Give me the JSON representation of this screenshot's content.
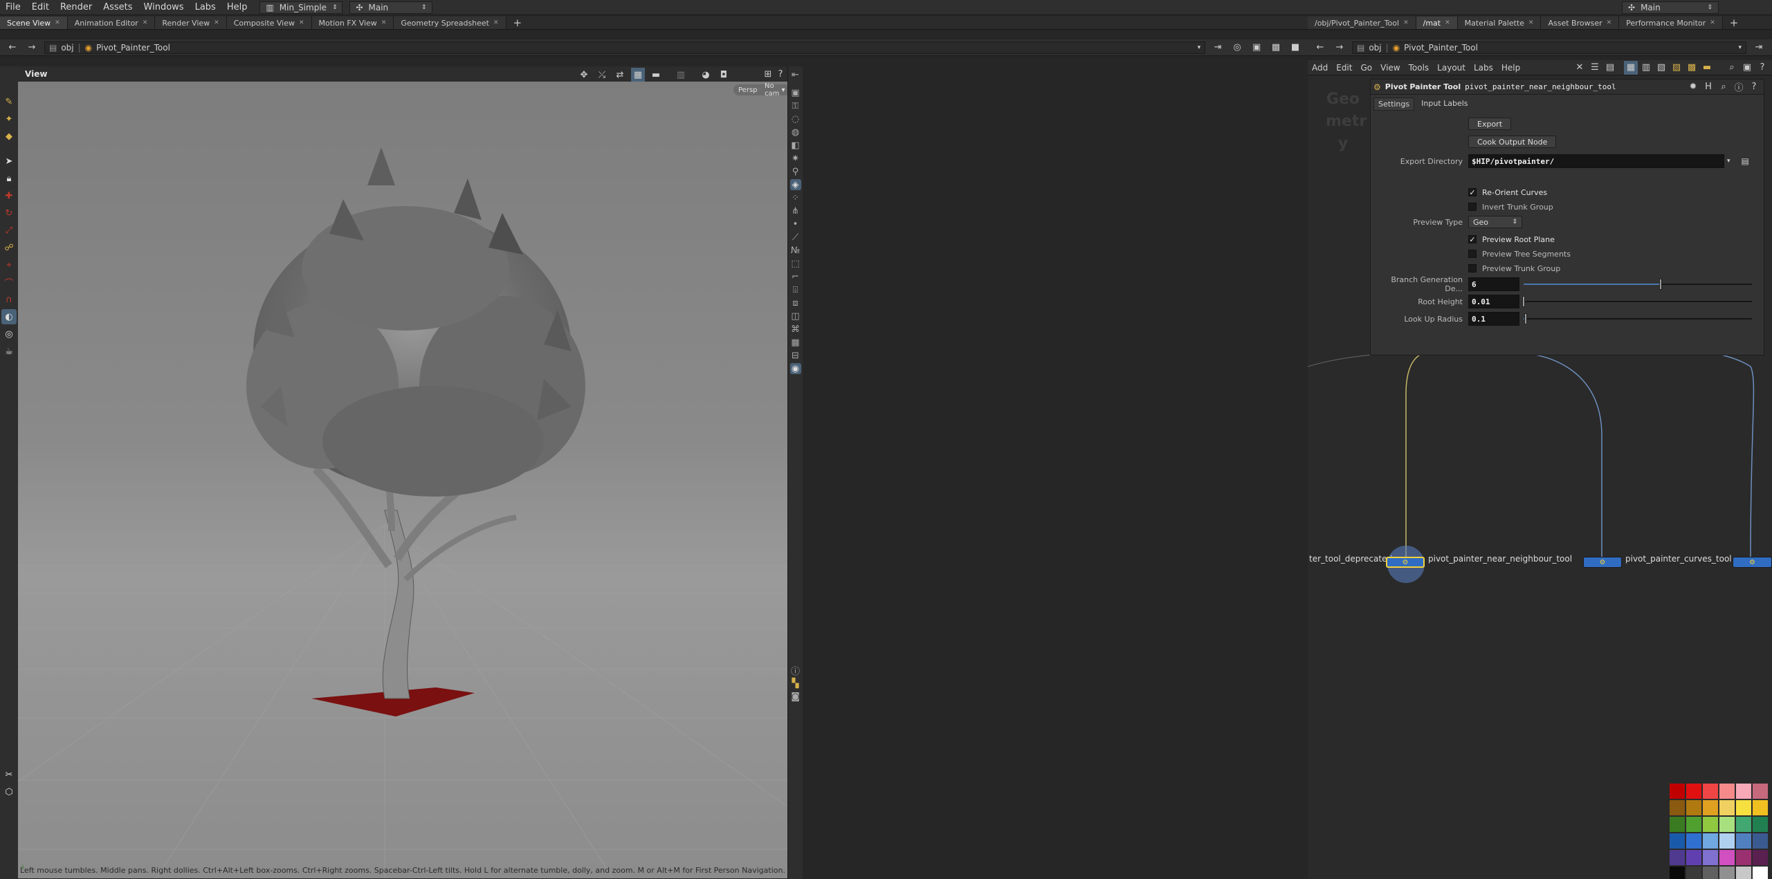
{
  "menubar": {
    "items": [
      "File",
      "Edit",
      "Render",
      "Assets",
      "Windows",
      "Labs",
      "Help"
    ],
    "desktop": "Min_Simple",
    "context": "Main",
    "right_context": "Main"
  },
  "left_tabs": [
    "Scene View",
    "Animation Editor",
    "Render View",
    "Composite View",
    "Motion FX View",
    "Geometry Spreadsheet"
  ],
  "right_tabs": [
    "/obj/Pivot_Painter_Tool",
    "/mat",
    "Material Palette",
    "Asset Browser",
    "Performance Monitor"
  ],
  "left_path": {
    "root": "obj",
    "node": "Pivot_Painter_Tool"
  },
  "right_path": {
    "root": "obj",
    "node": "Pivot_Painter_Tool"
  },
  "viewport": {
    "title": "View",
    "camera_persp": "Persp",
    "camera_name": "No cam",
    "status": "Left mouse tumbles. Middle pans. Right dollies. Ctrl+Alt+Left box-zooms. Ctrl+Right zooms. Spacebar-Ctrl-Left tilts. Hold L for alternate tumble, dolly, and zoom.     M or Alt+M for First Person Navigation."
  },
  "network_menu": [
    "Add",
    "Edit",
    "Go",
    "View",
    "Tools",
    "Layout",
    "Labs",
    "Help"
  ],
  "network_watermark": "Geo metr y",
  "params": {
    "node_type": "Pivot Painter Tool",
    "node_name": "pivot_painter_near_neighbour_tool",
    "tabs": [
      "Settings",
      "Input Labels"
    ],
    "export_btn": "Export",
    "cook_btn": "Cook Output Node",
    "export_dir_label": "Export Directory",
    "export_dir_value": "$HIP/pivotpainter/",
    "reorient_label": "Re-Orient Curves",
    "reorient_checked": true,
    "invert_trunk_label": "Invert Trunk Group",
    "invert_trunk_checked": false,
    "preview_type_label": "Preview Type",
    "preview_type_value": "Geo",
    "preview_root_label": "Preview Root Plane",
    "preview_root_checked": true,
    "preview_tree_label": "Preview Tree Segments",
    "preview_tree_checked": false,
    "preview_trunk_label": "Preview Trunk Group",
    "preview_trunk_checked": false,
    "branch_gen_label": "Branch Generation De...",
    "branch_gen_value": "6",
    "branch_gen_fraction": 0.6,
    "root_height_label": "Root Height",
    "root_height_value": "0.01",
    "root_height_fraction": 0.0,
    "lookup_label": "Look Up Radius",
    "lookup_value": "0.1",
    "lookup_fraction": 0.01
  },
  "nodes": {
    "left_label": "ter_tool_deprecated",
    "center_label": "pivot_painter_near_neighbour_tool",
    "right_label": "pivot_painter_curves_tool"
  },
  "colors": {
    "node_selected": "#f5d23a",
    "node_blue": "#2f6cc2",
    "root_plane": "#7a1010",
    "wire_yellow": "#c8b967",
    "wire_blue": "#6e8fbf"
  },
  "palette": [
    [
      "#c00000",
      "#e01010",
      "#f04545",
      "#f58a8a",
      "#f7a9b8",
      "#c7697c"
    ],
    [
      "#8a5a10",
      "#b07a10",
      "#e0a020",
      "#f0d060",
      "#f5e040",
      "#f0c020"
    ],
    [
      "#3a7a20",
      "#50a030",
      "#90c840",
      "#a8e080",
      "#40a870",
      "#208050"
    ],
    [
      "#1a5aaa",
      "#3070d0",
      "#70a8e0",
      "#b0d0f0",
      "#5080c0",
      "#3a5a90"
    ],
    [
      "#503a90",
      "#6040b0",
      "#8070d0",
      "#d050c0",
      "#9a3070",
      "#5a2050"
    ],
    [
      "#0a0a0a",
      "#3a3a3a",
      "#606060",
      "#909090",
      "#c8c8c8",
      "#ffffff"
    ]
  ]
}
